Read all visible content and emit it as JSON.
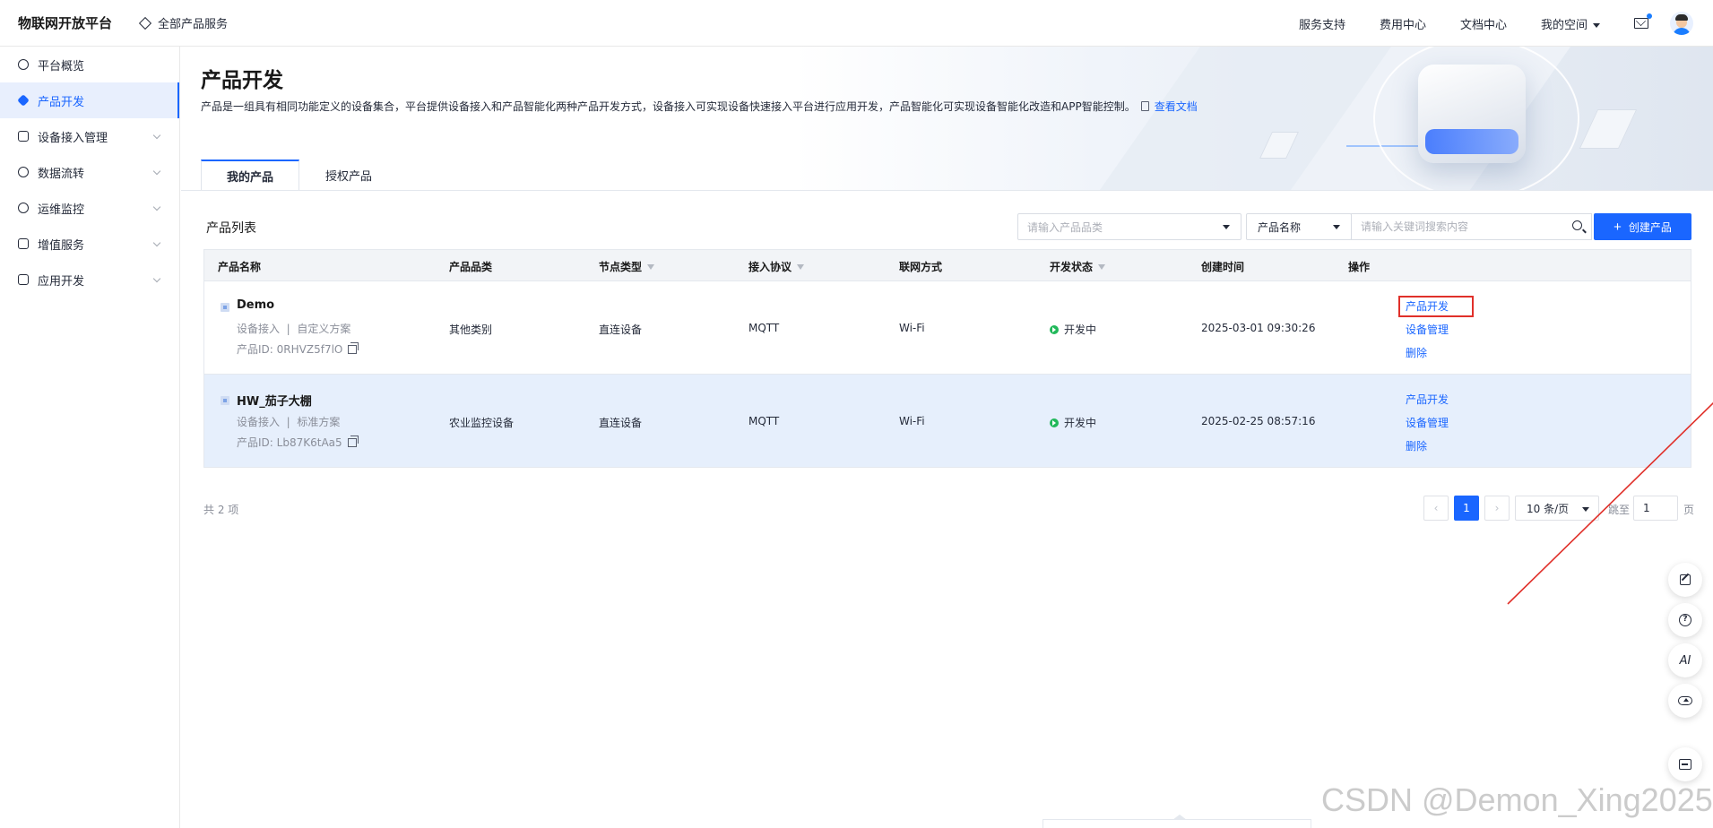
{
  "header": {
    "brand": "物联网开放平台",
    "all_products": "全部产品服务",
    "links": [
      "服务支持",
      "费用中心",
      "文档中心"
    ],
    "my_space": "我的空间"
  },
  "sidebar": {
    "items": [
      {
        "label": "平台概览",
        "active": false,
        "has_children": false
      },
      {
        "label": "产品开发",
        "active": true,
        "has_children": false
      },
      {
        "label": "设备接入管理",
        "active": false,
        "has_children": true
      },
      {
        "label": "数据流转",
        "active": false,
        "has_children": true
      },
      {
        "label": "运维监控",
        "active": false,
        "has_children": true
      },
      {
        "label": "增值服务",
        "active": false,
        "has_children": true
      },
      {
        "label": "应用开发",
        "active": false,
        "has_children": true
      }
    ]
  },
  "page": {
    "title": "产品开发",
    "description": "产品是一组具有相同功能定义的设备集合，平台提供设备接入和产品智能化两种产品开发方式，设备接入可实现设备快速接入平台进行应用开发，产品智能化可实现设备智能化改造和APP智能控制。",
    "doc_link": "查看文档",
    "tabs": [
      {
        "label": "我的产品",
        "active": true
      },
      {
        "label": "授权产品",
        "active": false
      }
    ],
    "list_title": "产品列表"
  },
  "filters": {
    "category_placeholder": "请输入产品品类",
    "field_select": "产品名称",
    "search_placeholder": "请输入关键词搜索内容",
    "create_button": "创建产品"
  },
  "table": {
    "columns": [
      "产品名称",
      "产品品类",
      "节点类型",
      "接入协议",
      "联网方式",
      "开发状态",
      "创建时间",
      "操作"
    ],
    "id_label": "产品ID:",
    "rows": [
      {
        "name": "Demo",
        "access": "设备接入",
        "solution": "自定义方案",
        "id": "0RHVZ5f7lO",
        "category": "其他类别",
        "node_type": "直连设备",
        "protocol": "MQTT",
        "network": "Wi-Fi",
        "status": "开发中",
        "created": "2025-03-01 09:30:26",
        "actions": [
          "产品开发",
          "设备管理",
          "删除"
        ]
      },
      {
        "name": "HW_茄子大棚",
        "access": "设备接入",
        "solution": "标准方案",
        "id": "Lb87K6tAa5",
        "category": "农业监控设备",
        "node_type": "直连设备",
        "protocol": "MQTT",
        "network": "Wi-Fi",
        "status": "开发中",
        "created": "2025-02-25 08:57:16",
        "actions": [
          "产品开发",
          "设备管理",
          "删除"
        ]
      }
    ]
  },
  "pagination": {
    "total_text": "共 2 项",
    "current_page": "1",
    "page_size": "10 条/页",
    "jump_label": "跳至",
    "jump_value": "1",
    "page_suffix": "页"
  },
  "floating_tools": {
    "ai_label": "AI"
  },
  "watermark": "CSDN @Demon_Xing2025",
  "colors": {
    "primary": "#1a66ff",
    "highlight_box": "#e0302a",
    "status_ok": "#21b85a"
  }
}
